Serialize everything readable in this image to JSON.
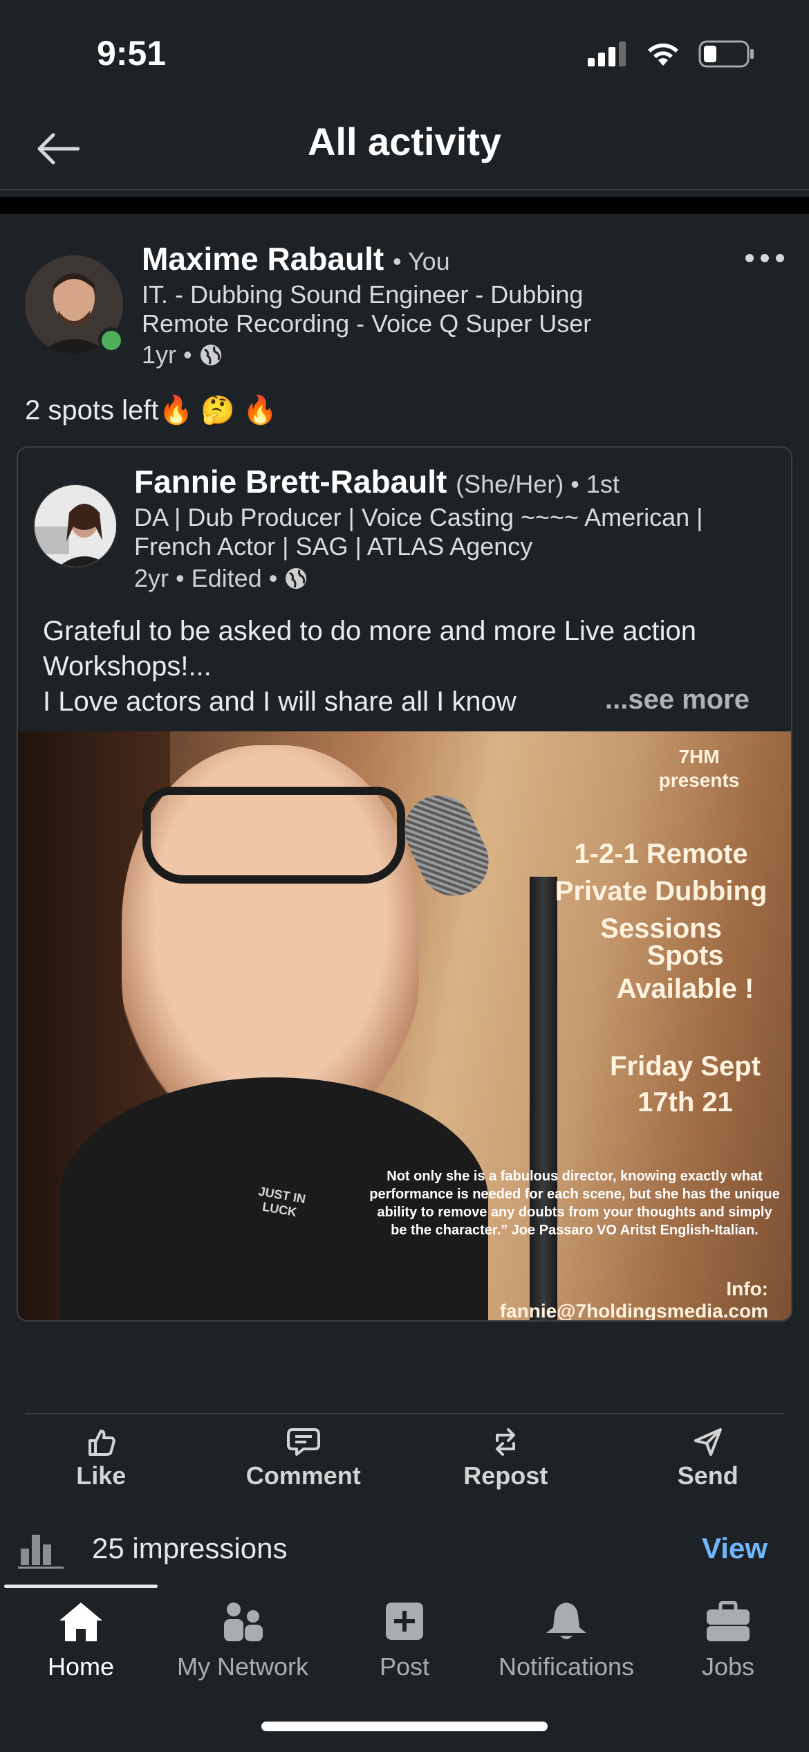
{
  "status_bar": {
    "time": "9:51"
  },
  "header": {
    "title": "All activity"
  },
  "post": {
    "author": {
      "name": "Maxime Rabault",
      "badge": "• You",
      "headline": "IT. - Dubbing Sound Engineer - Dubbing Remote Recording - Voice Q Super User",
      "time": "1yr •"
    },
    "text": "2 spots left🔥 🤔 🔥",
    "shared": {
      "author": {
        "name": "Fannie Brett-Rabault",
        "pronouns": "(She/Her) • 1st",
        "headline": "DA | Dub Producer | Voice Casting ~~~~ American | French Actor | SAG | ATLAS Agency",
        "time": "2yr • Edited •"
      },
      "text_line1": "Grateful to be asked to do more and more Live action Workshops!...",
      "text_line2": "I Love actors and I will share all I know",
      "see_more": "...see more",
      "image": {
        "brand": "7HM presents",
        "headline": "1-2-1 Remote Private Dubbing Sessions",
        "spots": "Spots Available !",
        "date": "Friday Sept 17th 21",
        "quote": "Not only she is a fabulous director, knowing exactly what performance is needed for each scene, but she has the unique ability to remove any doubts from your thoughts and simply be the character.” Joe Passaro VO Aritst English-Italian.",
        "info": "Info: fannie@7holdingsmedia.com",
        "shirt_text": "JUST IN LUCK"
      }
    },
    "actions": [
      {
        "label": "Like",
        "icon": "thumbs-up-icon"
      },
      {
        "label": "Comment",
        "icon": "comment-icon"
      },
      {
        "label": "Repost",
        "icon": "repost-icon"
      },
      {
        "label": "Send",
        "icon": "send-icon"
      }
    ],
    "impressions": {
      "text": "25 impressions",
      "view": "View"
    }
  },
  "tabbar": {
    "items": [
      {
        "label": "Home",
        "icon": "home-icon",
        "active": true
      },
      {
        "label": "My Network",
        "icon": "network-icon"
      },
      {
        "label": "Post",
        "icon": "post-icon"
      },
      {
        "label": "Notifications",
        "icon": "bell-icon"
      },
      {
        "label": "Jobs",
        "icon": "briefcase-icon"
      }
    ]
  },
  "colors": {
    "background": "#1d2226",
    "accent": "#71b7fb",
    "online": "#4fae5a"
  }
}
